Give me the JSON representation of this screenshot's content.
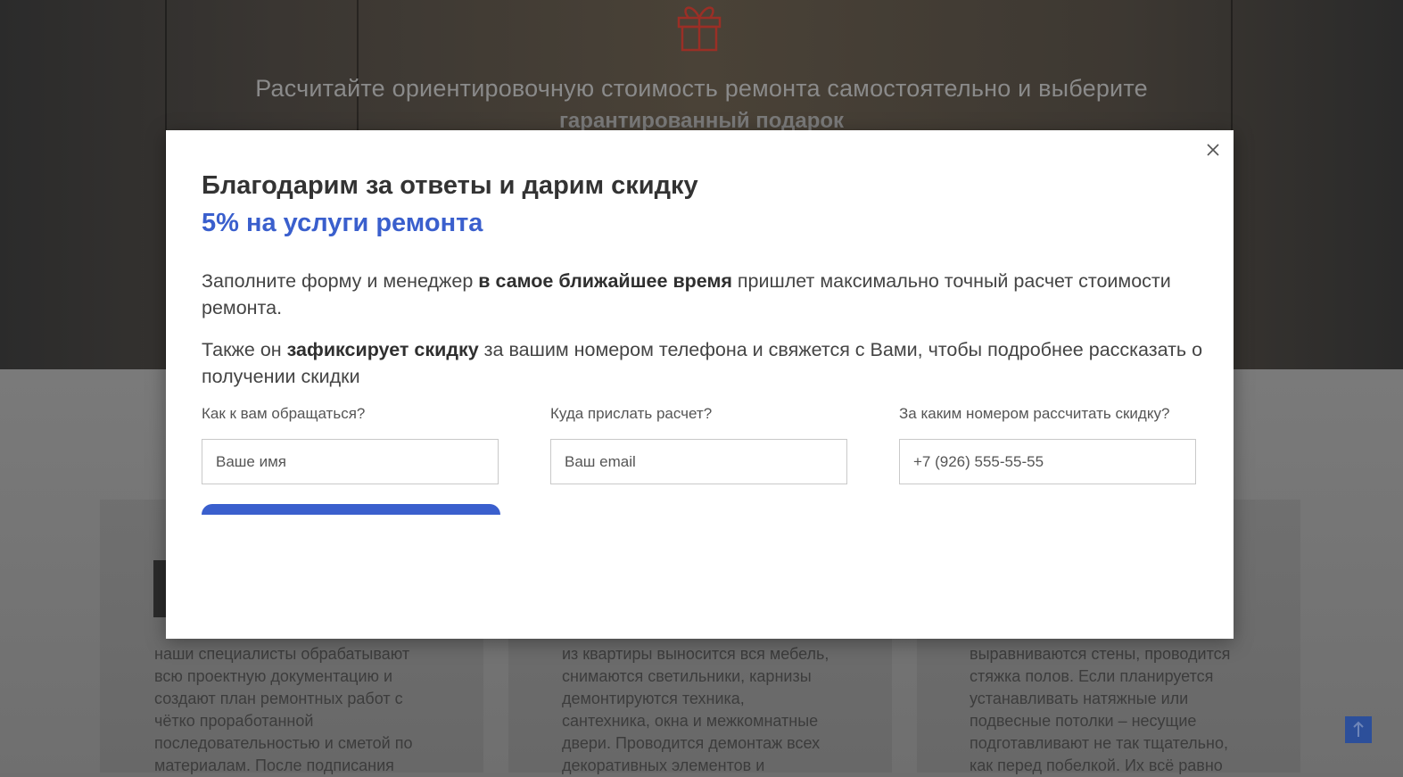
{
  "hero": {
    "line1": "Расчитайте ориентировочную стоимость ремонта самостоятельно и выберите",
    "line2": "гарантированный подарок"
  },
  "background_columns": [
    {
      "text": "наши специалисты обрабатывают всю проектную документацию и создают план ремонтных работ с чётко проработанной последовательностью и сметой по материалам. После подписания"
    },
    {
      "text": "из квартиры выносится вся мебель, снимаются светильники, карнизы демонтируются техника, сантехника, окна и межкомнатные двери. Проводится демонтаж всех декоративных элементов и"
    },
    {
      "text": "выравниваются стены, проводится стяжка полов. Если планируется устанавливать натяжные или подвесные потолки – несущие подготавливают не так тщательно, как перед побелкой. Их всё равно"
    }
  ],
  "modal": {
    "title": "Благодарим за ответы и дарим скидку",
    "subtitle": "5% на услуги ремонта",
    "para1": {
      "a": "Заполните форму и менеджер ",
      "b": "в самое ближайшее время",
      "c": " пришлет максимально точный расчет стоимости ремонта."
    },
    "para2": {
      "a": "Также он ",
      "b": "зафиксирует скидку",
      "c": " за вашим номером телефона и свяжется с Вами, чтобы подробнее рассказать о получении скидки"
    },
    "fields": [
      {
        "label": "Как к вам обращаться?",
        "placeholder": "Ваше имя"
      },
      {
        "label": "Куда прислать расчет?",
        "placeholder": "Ваш email"
      },
      {
        "label": "За каким номером рассчитать скидку?",
        "placeholder": "+7 (926) 555-55-55"
      }
    ]
  },
  "colors": {
    "accent": "#3a5fcd",
    "gift_icon": "#c0392b",
    "scroll_top_bg": "#2c4f9a"
  },
  "icons": {
    "close": "close-icon",
    "gift": "gift-icon",
    "scroll_top": "arrow-up-icon"
  }
}
